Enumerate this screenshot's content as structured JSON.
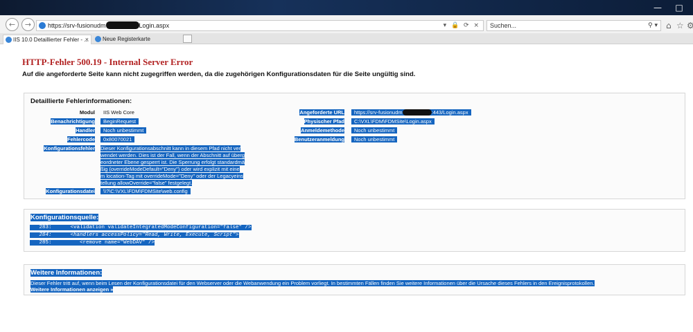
{
  "browser": {
    "url_start": "https://srv-fusionudm",
    "url_end": "Login.aspx",
    "search_placeholder": "Suchen...",
    "tabs": [
      {
        "label": "IIS 10.0 Detaillierter Fehler - ..."
      },
      {
        "label": "Neue Registerkarte"
      }
    ]
  },
  "page": {
    "title": "HTTP-Fehler 500.19 - Internal Server Error",
    "subtitle": "Auf die angeforderte Seite kann nicht zugegriffen werden, da die zugehörigen Konfigurationsdaten für die Seite ungültig sind.",
    "details": {
      "heading": "Detaillierte Fehlerinformationen:",
      "left": {
        "modul_label": "Modul",
        "modul_value": "IIS Web Core",
        "benachrichtigung_label": "Benachrichtigung",
        "benachrichtigung_value": "BeginRequest",
        "handler_label": "Handler",
        "handler_value": "Noch unbestimmt",
        "fehlercode_label": "Fehlercode",
        "fehlercode_value": "0x80070021",
        "konfigfehler_label": "Konfigurationsfehler",
        "konfigfehler_lines": [
          "Dieser Konfigurationsabschnitt kann in diesem Pfad nicht ver",
          "wendet werden. Dies ist der Fall, wenn der Abschnitt auf überg",
          "eordneter Ebene gesperrt ist. Die Sperrung erfolgt standardmä",
          "ßig (overrideModeDefault=\"Deny\") oder wird explizit mit eine",
          "m location-Tag mit overrideMode=\"Deny\" oder der Legacyeins",
          "tellung allowOverride=\"false\" festgelegt."
        ],
        "konfigdatei_label": "Konfigurationsdatei",
        "konfigdatei_value": "\\\\?\\C:\\VXL\\FDM\\FDMSite\\web.config"
      },
      "right": {
        "url_label": "Angeforderte URL",
        "url_value_start": "https://srv-fusionudm",
        "url_value_end": ":443/Login.aspx",
        "pfad_label": "Physischer Pfad",
        "pfad_value": "C:\\VXL\\FDM\\FDMSite\\Login.aspx",
        "anmeldemethode_label": "Anmeldemethode",
        "anmeldemethode_value": "Noch unbestimmt",
        "benutzer_label": "Benutzeranmeldung",
        "benutzer_value": "Noch unbestimmt"
      }
    },
    "source": {
      "heading": "Konfigurationsquelle:",
      "lines": [
        "   283:      <validation validateIntegratedModeConfiguration=\"false\" />",
        "   284:      <handlers accessPolicy=\"Read, Write, Execute, Script\">",
        "   285:         <remove name=\"WebDAV\" />"
      ]
    },
    "more": {
      "heading": "Weitere Informationen:",
      "text": "Dieser Fehler tritt auf, wenn beim Lesen der Konfigurationsdatei für den Webserver oder die Webanwendung ein Problem vorliegt. In bestimmten Fällen finden Sie weitere Informationen über die Ursache dieses Fehlers in den Ereignisprotokollen.",
      "link": "Weitere Informationen anzeigen »"
    }
  }
}
